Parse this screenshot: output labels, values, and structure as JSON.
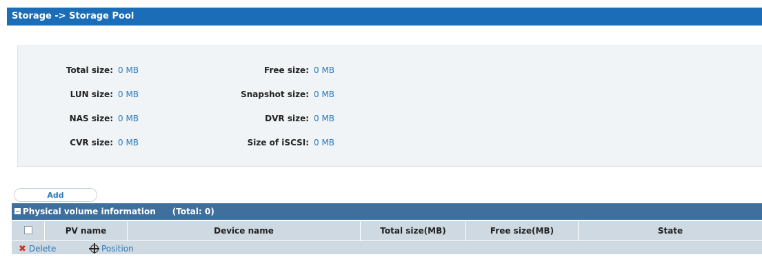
{
  "header": {
    "title": "Storage -> Storage Pool"
  },
  "summary": {
    "total_size": {
      "label": "Total size:",
      "value": "0 MB"
    },
    "free_size": {
      "label": "Free size:",
      "value": "0 MB"
    },
    "lun_size": {
      "label": "LUN size:",
      "value": "0 MB"
    },
    "snapshot_size": {
      "label": "Snapshot size:",
      "value": "0 MB"
    },
    "nas_size": {
      "label": "NAS size:",
      "value": "0 MB"
    },
    "dvr_size": {
      "label": "DVR size:",
      "value": "0 MB"
    },
    "cvr_size": {
      "label": "CVR size:",
      "value": "0 MB"
    },
    "iscsi_size": {
      "label": "Size of iSCSI:",
      "value": "0 MB"
    }
  },
  "toolbar": {
    "add_label": "Add"
  },
  "pv_table": {
    "title": "Physical volume information",
    "total": "(Total: 0)",
    "columns": [
      "PV name",
      "Device name",
      "Total size(MB)",
      "Free size(MB)",
      "State"
    ],
    "actions": {
      "delete": "Delete",
      "position": "Position"
    }
  },
  "colors": {
    "header_bg": "#1a6db6",
    "table_header_bg": "#3f6f9c",
    "link": "#2a7ab8",
    "delete_icon": "#d52a1c"
  },
  "icons": [
    "collapse-icon",
    "delete-icon",
    "position-icon"
  ]
}
